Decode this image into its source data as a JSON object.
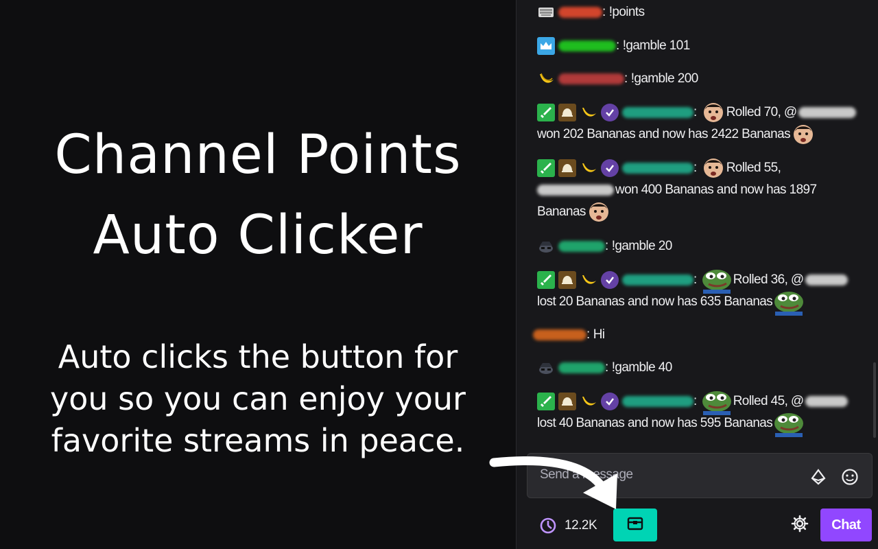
{
  "promo": {
    "title_line1": "Channel Points",
    "title_line2": "Auto Clicker",
    "subtitle_line1": "Auto clicks the button for",
    "subtitle_line2": "you so you can enjoy your",
    "subtitle_line3": "favorite streams in peace."
  },
  "chat": {
    "messages": [
      {
        "text": "!points"
      },
      {
        "text": "!gamble 101"
      },
      {
        "text": "!gamble 200"
      },
      {
        "line1": "Rolled 70, @",
        "line2": "won 202 Bananas and now has 2422 Bananas"
      },
      {
        "line1": "Rolled 55,",
        "line2": "won 400 Bananas and now has 1897",
        "line3": "Bananas"
      },
      {
        "text": "!gamble 20"
      },
      {
        "line1": "Rolled 36, @",
        "line2": "lost 20 Bananas and now has 635 Bananas"
      },
      {
        "text": "Hi"
      },
      {
        "text": "!gamble 40"
      },
      {
        "line1": "Rolled 45, @",
        "line2": "lost 40 Bananas and now has 595 Bananas"
      }
    ],
    "input_placeholder": "Send a message",
    "points_value": "12.2K",
    "chat_button_label": "Chat"
  },
  "colors": {
    "background": "#0e0e10",
    "chat_panel": "#18181b",
    "claim_button": "#00d4b4",
    "chat_button": "#9147ff"
  },
  "icons": {
    "input_left": "bits-diamond-icon",
    "input_right": "emote-smiley-icon",
    "points": "channel-points-icon",
    "claim": "treasure-chest-icon",
    "settings": "gear-icon"
  }
}
